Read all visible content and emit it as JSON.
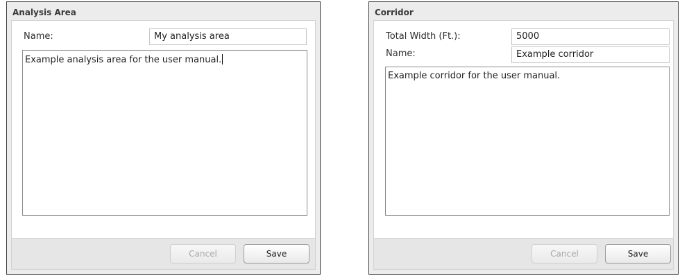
{
  "analysis_area": {
    "title": "Analysis Area",
    "name_label": "Name:",
    "name_value": "My analysis area",
    "description": "Example analysis area for the user manual.",
    "cancel_label": "Cancel",
    "save_label": "Save"
  },
  "corridor": {
    "title": "Corridor",
    "width_label": "Total Width (Ft.):",
    "width_value": "5000",
    "name_label": "Name:",
    "name_value": "Example corridor",
    "description": "Example corridor for the user manual.",
    "cancel_label": "Cancel",
    "save_label": "Save"
  }
}
